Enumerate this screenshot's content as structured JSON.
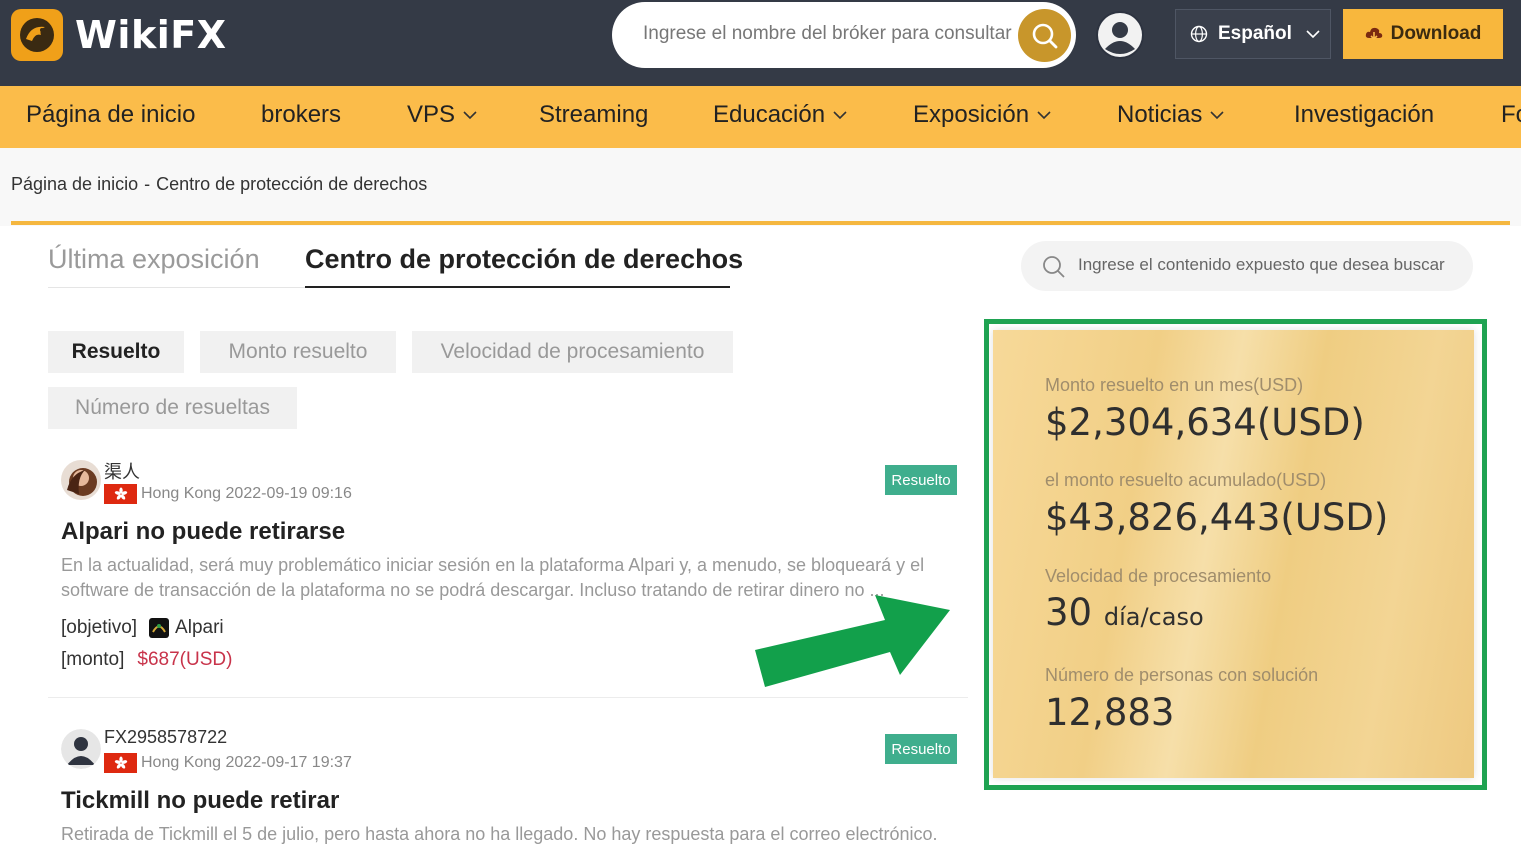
{
  "header": {
    "brand": "WikiFX",
    "search_placeholder": "Ingrese el nombre del bróker para consultar",
    "language": "Español",
    "download": "Download"
  },
  "nav": [
    "Página de inicio",
    "brokers",
    "VPS",
    "Streaming",
    "Educación",
    "Exposición",
    "Noticias",
    "Investigación",
    "Fo"
  ],
  "breadcrumb": {
    "home": "Página de inicio",
    "separator": "-",
    "current": "Centro de protección de derechos"
  },
  "tabs": {
    "latest": "Última exposición",
    "center": "Centro de protección de derechos"
  },
  "content_search_placeholder": "Ingrese el contenido expuesto que desea buscar",
  "filters": [
    "Resuelto",
    "Monto resuelto",
    "Velocidad de procesamiento",
    "Número de resueltas"
  ],
  "cases": [
    {
      "user": "渠人",
      "location": "Hong Kong",
      "date": "2022-09-19 09:16",
      "status": "Resuelto",
      "title": "Alpari no puede retirarse",
      "body": "En la actualidad, será muy problemático iniciar sesión en la plataforma Alpari y, a menudo, se bloqueará y el software de transacción de la plataforma no se podrá descargar. Incluso tratando de retirar dinero no ...",
      "target_label": "[objetivo]",
      "target": "Alpari",
      "amount_label": "[monto]",
      "amount": "$687(USD)"
    },
    {
      "user": "FX2958578722",
      "location": "Hong Kong",
      "date": "2022-09-17 19:37",
      "status": "Resuelto",
      "title": "Tickmill no puede retirar",
      "body": "Retirada de Tickmill el 5 de julio, pero hasta ahora no ha llegado. No hay respuesta para el correo electrónico."
    }
  ],
  "stats": {
    "month_label": "Monto resuelto en un mes(USD)",
    "month_value": "$2,304,634(USD)",
    "total_label": "el monto resuelto acumulado(USD)",
    "total_value": "$43,826,443(USD)",
    "speed_label": "Velocidad de procesamiento",
    "speed_value": "30",
    "speed_unit": "día/caso",
    "people_label": "Número de personas con solución",
    "people_value": "12,883"
  },
  "colors": {
    "header_bg": "#343a46",
    "nav_bg": "#fbbc4a",
    "accent": "#f5b73f",
    "badge": "#3fae8d",
    "highlight_frame": "#1fa352",
    "amount": "#c8334a"
  }
}
